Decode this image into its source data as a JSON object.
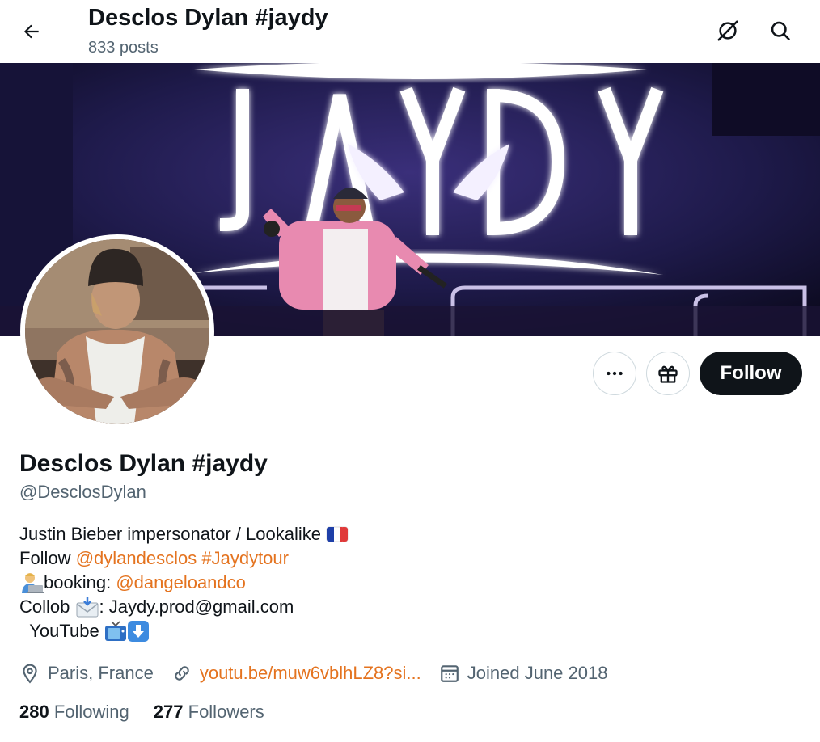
{
  "header": {
    "title": "Desclos Dylan #jaydy",
    "post_count": "833 posts",
    "icons": [
      "back-arrow-icon",
      "no-connection-icon",
      "search-icon"
    ]
  },
  "banner": {
    "sign_text": "JAYDY"
  },
  "actions": {
    "more_icon": "more-dots-icon",
    "gift_icon": "gift-icon",
    "follow_label": "Follow"
  },
  "profile": {
    "name": "Desclos Dylan #jaydy",
    "handle": "@DesclosDylan",
    "bio": {
      "line1": "Justin Bieber impersonator / Lookalike",
      "line2_prefix": "Follow",
      "line2_mention": "@dylandesclos",
      "line2_hashtag": "#Jaydytour",
      "line3_prefix": "booking:",
      "line3_mention": "@dangeloandco",
      "line4_prefix": "Collob",
      "line4_suffix": ": Jaydy.prod@gmail.com",
      "line5": "YouTube"
    },
    "location": "Paris, France",
    "website": "youtu.be/muw6vblhLZ8?si...",
    "joined": "Joined June 2018",
    "following_count": "280",
    "following_label": "Following",
    "followers_count": "277",
    "followers_label": "Followers"
  },
  "colors": {
    "link": "#e4731f",
    "follow_bg": "#0f1419",
    "muted": "#536471"
  }
}
